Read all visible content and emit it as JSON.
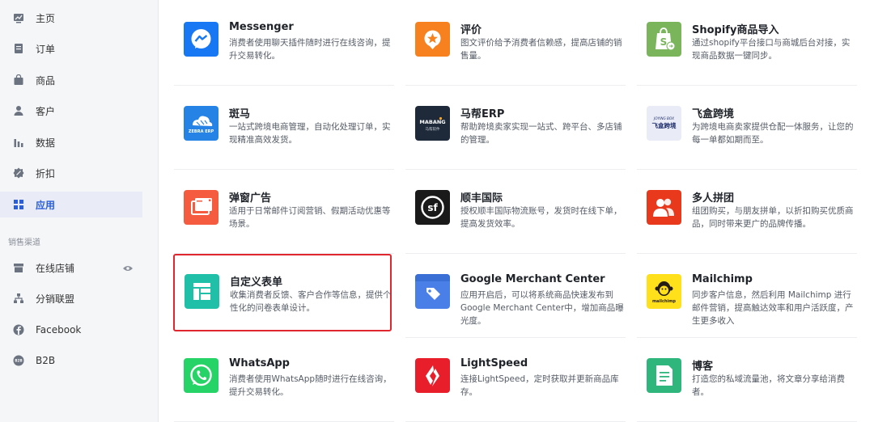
{
  "sidebar": {
    "items": [
      {
        "label": "主页",
        "icon": "chart-icon"
      },
      {
        "label": "订单",
        "icon": "order-icon"
      },
      {
        "label": "商品",
        "icon": "bag-icon"
      },
      {
        "label": "客户",
        "icon": "user-icon"
      },
      {
        "label": "数据",
        "icon": "bar-chart-icon"
      },
      {
        "label": "折扣",
        "icon": "discount-icon"
      },
      {
        "label": "应用",
        "icon": "apps-grid-icon",
        "active": true
      }
    ],
    "section_label": "销售渠道",
    "channels": [
      {
        "label": "在线店铺",
        "icon": "store-icon"
      },
      {
        "label": "分销联盟",
        "icon": "network-icon"
      },
      {
        "label": "Facebook",
        "icon": "facebook-icon"
      },
      {
        "label": "B2B",
        "icon": "b2b-icon"
      }
    ]
  },
  "apps": [
    {
      "title": "Messenger",
      "desc": "消费者使用聊天插件随时进行在线咨询，提升交易转化。",
      "icon": "messenger-icon",
      "color": "#1877f2"
    },
    {
      "title": "评价",
      "desc": "图文评价给予消费者信赖感，提高店铺的销售量。",
      "icon": "star-badge-icon",
      "color": "#f7811e"
    },
    {
      "title": "Shopify商品导入",
      "desc": "通过shopify平台接口与商城后台对接，实现商品数据一键同步。",
      "icon": "shopify-icon",
      "color": "#7ab55c"
    },
    {
      "title": "斑马",
      "desc": "一站式跨境电商管理，自动化处理订单，实现精准高效发货。",
      "icon": "zebra-erp-icon",
      "color": "#2583e6",
      "icon_text": "ZEBRA ERP"
    },
    {
      "title": "马帮ERP",
      "desc": "帮助跨境卖家实现一站式、跨平台、多店铺的管理。",
      "icon": "mabang-icon",
      "color": "#1e2a3a",
      "icon_text": "MABANG",
      "icon_subtext": "马帮软件"
    },
    {
      "title": "飞盒跨境",
      "desc": "为跨境电商卖家提供仓配一体服务，让您的每一单都如期而至。",
      "icon": "feihe-icon",
      "color": "#e9ecf7",
      "icon_text": "JOYING BOX",
      "icon_subtext": "飞盒跨境"
    },
    {
      "title": "弹窗广告",
      "desc": "适用于日常邮件订阅营销、假期活动优惠等场景。",
      "icon": "popup-icon",
      "color": "#f45b3f"
    },
    {
      "title": "顺丰国际",
      "desc": "授权顺丰国际物流账号，发货时在线下单，提高发货效率。",
      "icon": "sf-icon",
      "color": "#1a1a1a"
    },
    {
      "title": "多人拼团",
      "desc": "组团购买，与朋友拼单，以折扣购买优质商品，同时带来更广的品牌传播。",
      "icon": "group-buy-icon",
      "color": "#e8391c"
    },
    {
      "title": "自定义表单",
      "desc": "收集消费者反馈、客户合作等信息，提供个性化的问卷表单设计。",
      "icon": "form-icon",
      "color": "#1fbfa8"
    },
    {
      "title": "Google Merchant Center",
      "desc": "应用开启后，可以将系统商品快速发布到Google Merchant Center中，增加商品曝光度。",
      "icon": "google-merchant-icon",
      "color": "#4a7fe8"
    },
    {
      "title": "Mailchimp",
      "desc": "同步客户信息，然后利用 Mailchimp 进行邮件营销，提高触达效率和用户活跃度，产生更多收入",
      "icon": "mailchimp-icon",
      "color": "#ffe01b",
      "icon_text": "mailchimp"
    },
    {
      "title": "WhatsApp",
      "desc": "消费者使用WhatsApp随时进行在线咨询，提升交易转化。",
      "icon": "whatsapp-icon",
      "color": "#25d366"
    },
    {
      "title": "LightSpeed",
      "desc": "连接LightSpeed，定时获取并更新商品库存。",
      "icon": "lightspeed-icon",
      "color": "#e81e2b"
    },
    {
      "title": "博客",
      "desc": "打造您的私域流量池，将文章分享给消费者。",
      "icon": "blog-icon",
      "color": "#2eb67d"
    }
  ]
}
